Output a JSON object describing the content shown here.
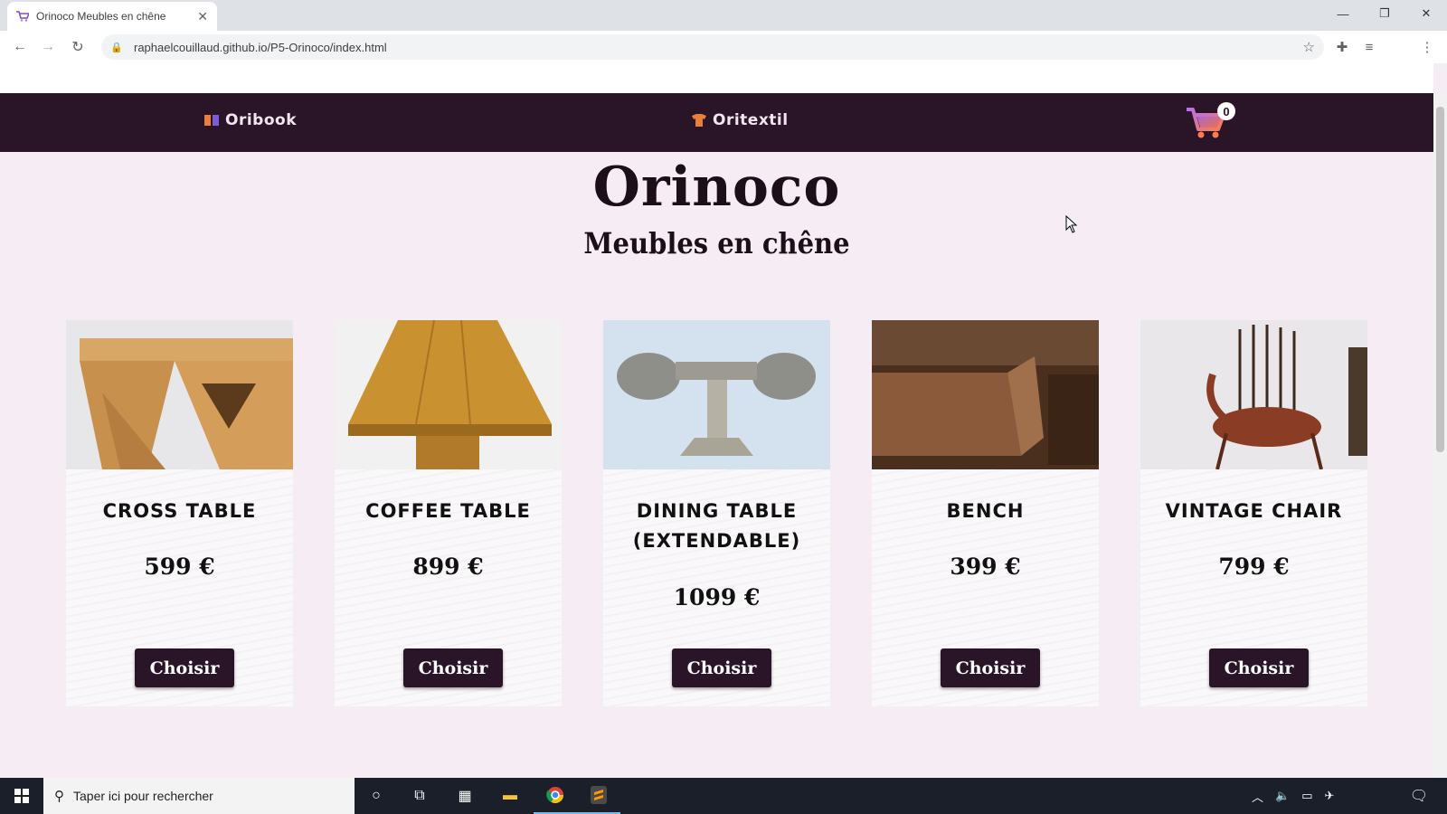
{
  "browser": {
    "tab_title": "Orinoco Meubles en chêne",
    "url": "raphaelcouillaud.github.io/P5-Orinoco/index.html"
  },
  "nav": {
    "link1": "Oribook",
    "link2": "Oritextil",
    "cart_count": "0"
  },
  "hero": {
    "title": "Orinoco",
    "subtitle": "Meubles en chêne"
  },
  "products": [
    {
      "name": "CROSS TABLE",
      "price": "599 €",
      "button": "Choisir"
    },
    {
      "name": "COFFEE TABLE",
      "price": "899 €",
      "button": "Choisir"
    },
    {
      "name": "DINING TABLE (EXTENDABLE)",
      "price": "1099 €",
      "button": "Choisir"
    },
    {
      "name": "BENCH",
      "price": "399 €",
      "button": "Choisir"
    },
    {
      "name": "VINTAGE CHAIR",
      "price": "799 €",
      "button": "Choisir"
    }
  ],
  "taskbar": {
    "search_placeholder": "Taper ici pour rechercher"
  },
  "colors": {
    "nav_bg": "#2a1528",
    "page_bg": "#f6ecf4",
    "button_bg": "#2a1528"
  }
}
